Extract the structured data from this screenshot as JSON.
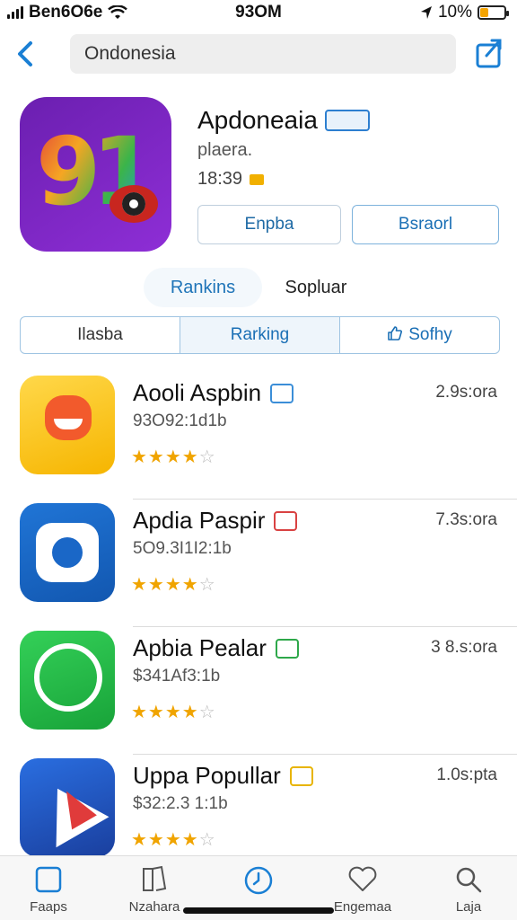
{
  "status": {
    "carrier": "Ben6O6e",
    "time": "93OM",
    "battery": "10%"
  },
  "nav": {
    "search_value": "Ondonesia"
  },
  "app": {
    "title": "Apdoneaia",
    "subtitle": "plaera.",
    "meta": "18:39",
    "btn_left": "Enpba",
    "btn_right": "Bsraorl"
  },
  "segments": {
    "active": "Rankins",
    "plain": "Sopluar"
  },
  "tabs": [
    {
      "label": "Ilasba"
    },
    {
      "label": "Rarking"
    },
    {
      "label": "Sofhy"
    }
  ],
  "list": [
    {
      "title": "Aooli Aspbin",
      "sub": "93O92:1d1b",
      "right": "2.9s:ora",
      "rating": 3.5,
      "icon": "cat-face-icon",
      "badge_color": "#3b8ed8"
    },
    {
      "title": "Apdia Paspir",
      "sub": "5O9.3I1I2:1b",
      "right": "7.3s:ora",
      "rating": 4.0,
      "icon": "q-logo-icon",
      "badge_color": "#d94242"
    },
    {
      "title": "Apbia Pealar",
      "sub": "$341Af3:1b",
      "right": "3 8.s:ora",
      "rating": 4.0,
      "icon": "phone-icon",
      "badge_color": "#2ea84a"
    },
    {
      "title": "Uppa Popullar",
      "sub": "$32:2.3 1:1b",
      "right": "1.0s:pta",
      "rating": 4.0,
      "icon": "arrow-logo-icon",
      "badge_color": "#e8b400"
    }
  ],
  "tabbar": [
    {
      "label": "Faaps",
      "icon": "square-icon"
    },
    {
      "label": "Nzahara",
      "icon": "book-icon"
    },
    {
      "label": "",
      "icon": "clock-icon"
    },
    {
      "label": "Engemaa",
      "icon": "heart-icon"
    },
    {
      "label": "Laja",
      "icon": "search-icon"
    }
  ],
  "colors": {
    "accent": "#1a7fd4",
    "star": "#f0a400",
    "app_icon_bg": "#7a24c4"
  }
}
